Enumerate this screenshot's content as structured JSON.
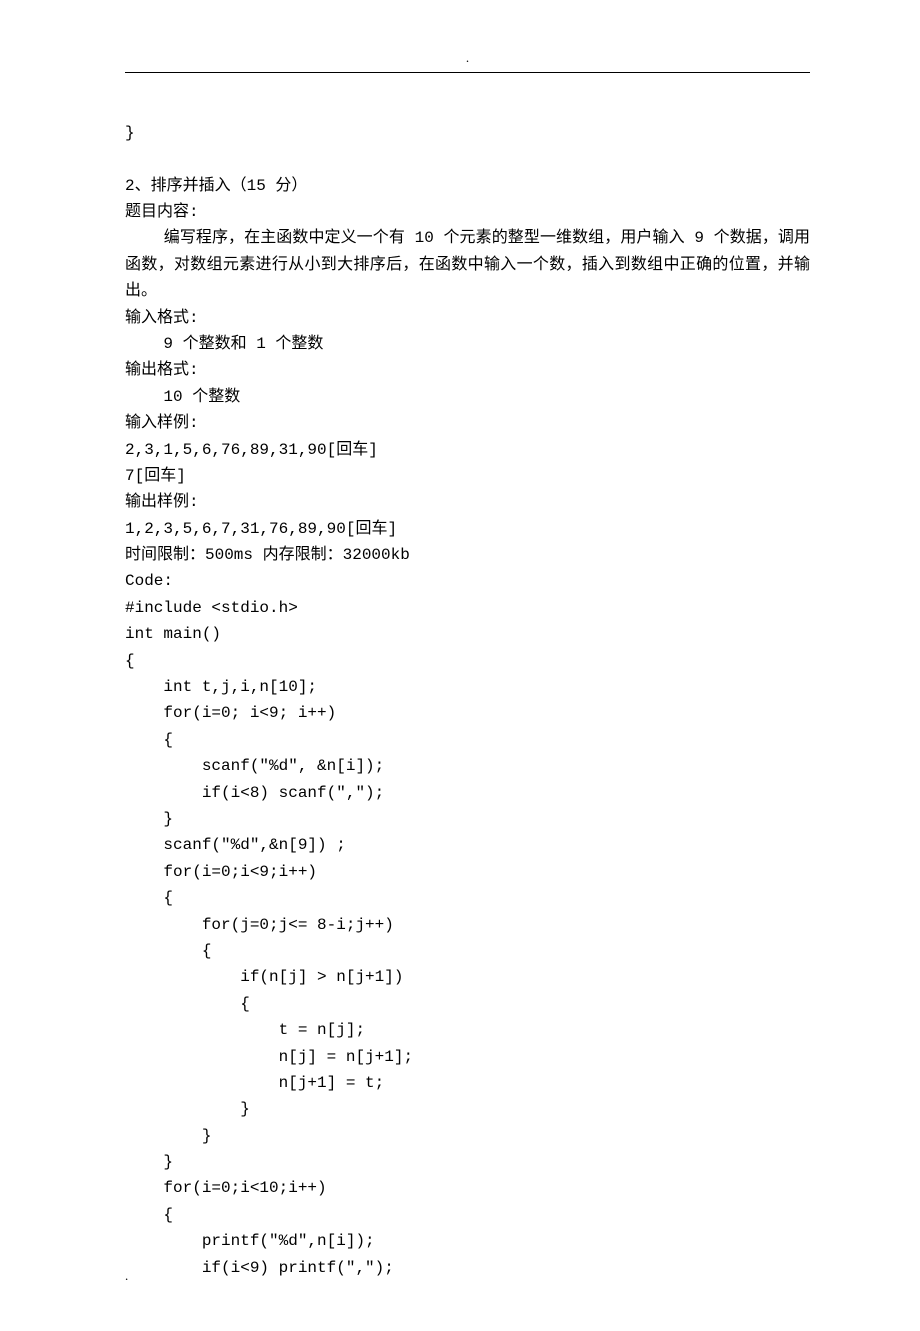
{
  "closing_brace": "}",
  "problem": {
    "number_title": "2、排序并插入（15 分）",
    "section_content_label": "题目内容:",
    "content_body": "    编写程序，在主函数中定义一个有 10 个元素的整型一维数组，用户输入 9 个数据，调用函数，对数组元素进行从小到大排序后，在函数中输入一个数，插入到数组中正确的位置，并输出。",
    "input_format_label": "输入格式:",
    "input_format_body": "    9 个整数和 1 个整数",
    "output_format_label": "输出格式:",
    "output_format_body": "    10 个整数",
    "input_sample_label": "输入样例:",
    "input_sample_line1": "2,3,1,5,6,76,89,31,90[回车]",
    "input_sample_line2": "7[回车]",
    "output_sample_label": "输出样例:",
    "output_sample_line1": "1,2,3,5,6,7,31,76,89,90[回车]",
    "limits": "时间限制：500ms 内存限制：32000kb",
    "code_label": "Code:"
  },
  "code": {
    "l01": "#include <stdio.h>",
    "l02": "int main()",
    "l03": "{",
    "l04": "    int t,j,i,n[10];",
    "l05": "    for(i=0; i<9; i++)",
    "l06": "    {",
    "l07": "        scanf(\"%d\", &n[i]);",
    "l08": "        if(i<8) scanf(\",\");",
    "l09": "    }",
    "l10": "    scanf(\"%d\",&n[9]) ;",
    "l11": "    for(i=0;i<9;i++)",
    "l12": "    {",
    "l13": "        for(j=0;j<= 8-i;j++)",
    "l14": "        {",
    "l15": "            if(n[j] > n[j+1])",
    "l16": "            {",
    "l17": "                t = n[j];",
    "l18": "                n[j] = n[j+1];",
    "l19": "                n[j+1] = t;",
    "l20": "            }",
    "l21": "        }",
    "l22": "    }",
    "l23": "    for(i=0;i<10;i++)",
    "l24": "    {",
    "l25": "        printf(\"%d\",n[i]);",
    "l26": "        if(i<9) printf(\",\");"
  },
  "header_dot": ".",
  "footer_dot": "."
}
